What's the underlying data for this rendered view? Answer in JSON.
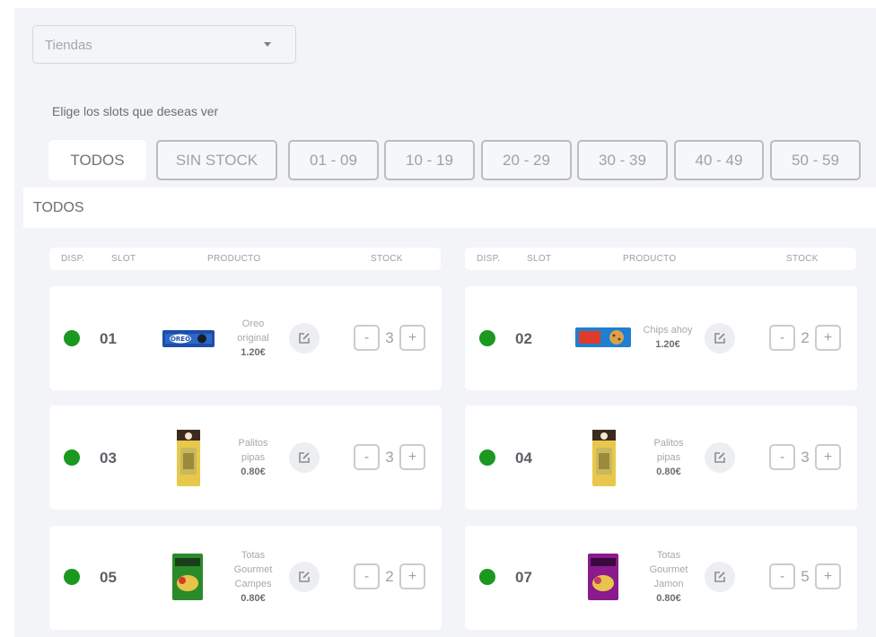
{
  "store_select": {
    "placeholder": "Tiendas",
    "icon": "chevron-down-icon"
  },
  "subtitle": "Elige los slots que deseas ver",
  "filters": [
    {
      "label": "TODOS",
      "active": true
    },
    {
      "label": "SIN STOCK",
      "active": false
    },
    {
      "label": "01 - 09",
      "active": false
    },
    {
      "label": "10 - 19",
      "active": false
    },
    {
      "label": "20 - 29",
      "active": false
    },
    {
      "label": "30 - 39",
      "active": false
    },
    {
      "label": "40 - 49",
      "active": false
    },
    {
      "label": "50 - 59",
      "active": false
    }
  ],
  "section_title": "TODOS",
  "table_headers": {
    "disp": "DISP.",
    "slot": "SLOT",
    "producto": "PRODUCTO",
    "stock": "STOCK"
  },
  "status_color": "#1a9820",
  "stepper": {
    "minus": "-",
    "plus": "+"
  },
  "slots": [
    {
      "slot": "01",
      "name": [
        "Oreo",
        "original"
      ],
      "price": "1.20€",
      "stock": "3",
      "available": true,
      "product_icon": "cookie-pack-icon"
    },
    {
      "slot": "02",
      "name": [
        "Chips ahoy"
      ],
      "price": "1.20€",
      "stock": "2",
      "available": true,
      "product_icon": "cookie-pack-icon"
    },
    {
      "slot": "03",
      "name": [
        "Palitos",
        "pipas"
      ],
      "price": "0.80€",
      "stock": "3",
      "available": true,
      "product_icon": "snack-bag-icon"
    },
    {
      "slot": "04",
      "name": [
        "Palitos",
        "pipas"
      ],
      "price": "0.80€",
      "stock": "3",
      "available": true,
      "product_icon": "snack-bag-icon"
    },
    {
      "slot": "05",
      "name": [
        "Totas",
        "Gourmet",
        "Campes"
      ],
      "price": "0.80€",
      "stock": "2",
      "available": true,
      "product_icon": "chips-bag-icon"
    },
    {
      "slot": "07",
      "name": [
        "Totas",
        "Gourmet",
        "Jamon"
      ],
      "price": "0.80€",
      "stock": "5",
      "available": true,
      "product_icon": "chips-bag-icon"
    }
  ]
}
